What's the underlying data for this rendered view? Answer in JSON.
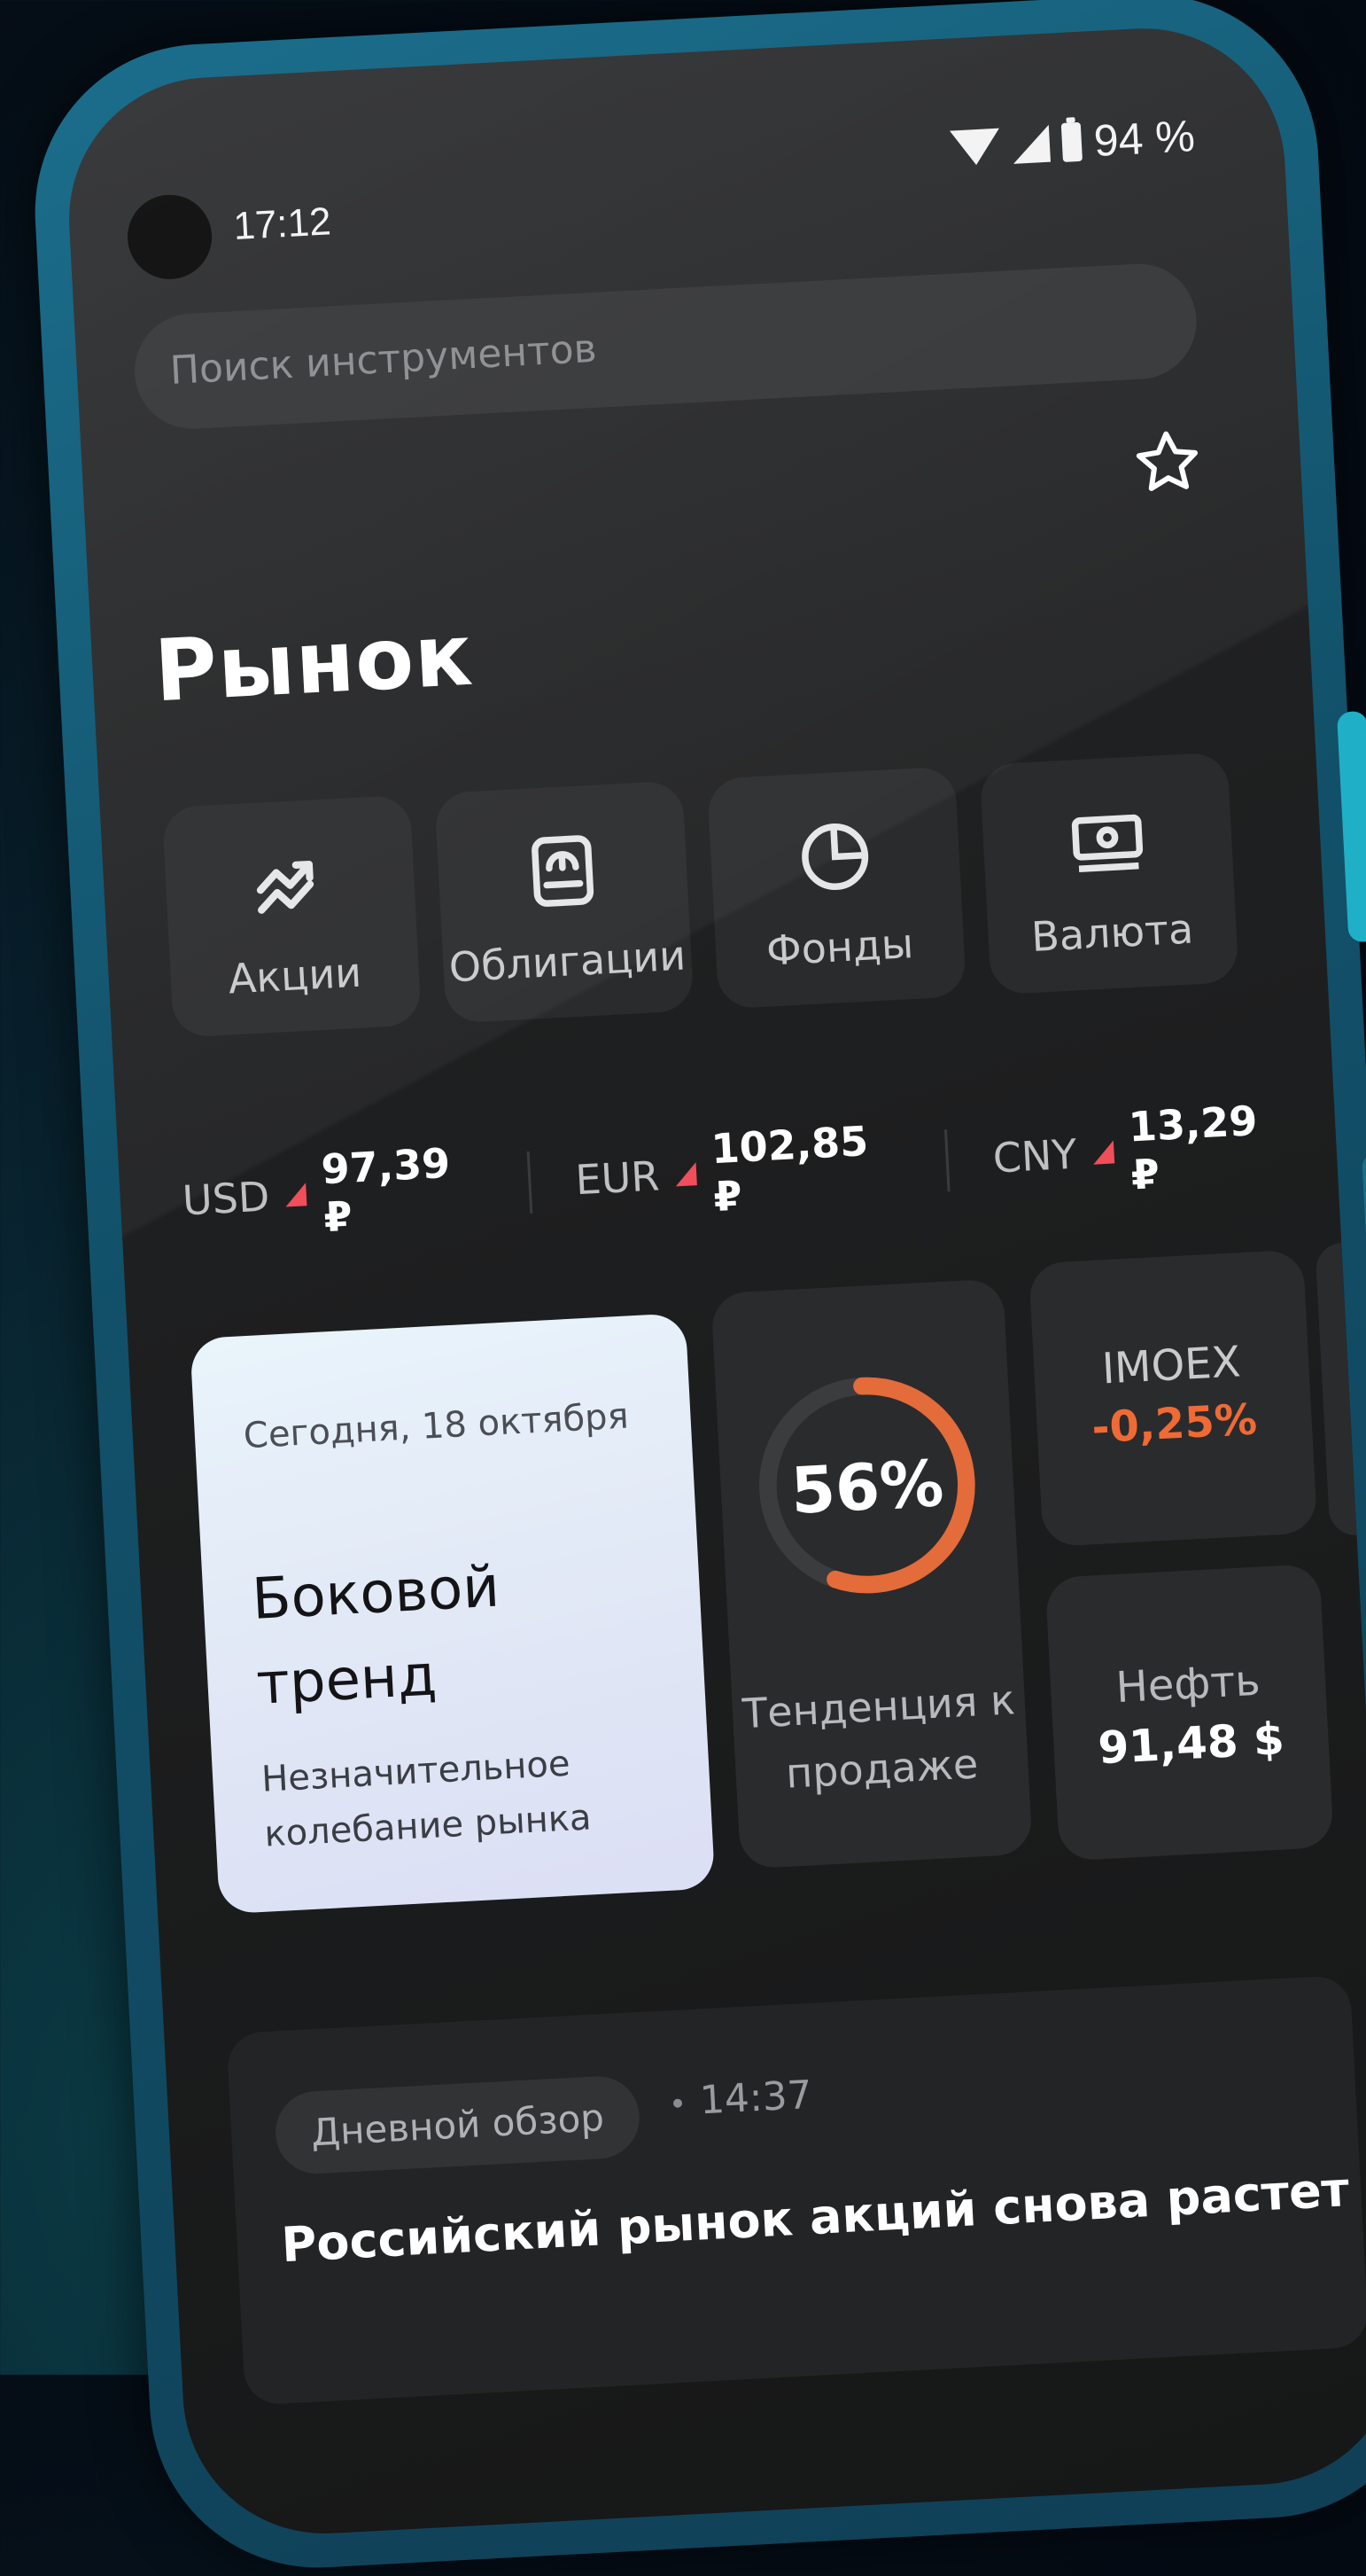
{
  "status_bar": {
    "time": "17:12",
    "battery": "94 %"
  },
  "search": {
    "placeholder": "Поиск инструментов"
  },
  "page": {
    "title": "Рынок"
  },
  "categories": [
    {
      "label": "Акции",
      "icon": "trend-chart-icon"
    },
    {
      "label": "Облигации",
      "icon": "bond-document-icon"
    },
    {
      "label": "Фонды",
      "icon": "pie-chart-icon"
    },
    {
      "label": "Валюта",
      "icon": "banknote-icon"
    }
  ],
  "rates": [
    {
      "code": "USD",
      "value": "97,39 ₽"
    },
    {
      "code": "EUR",
      "value": "102,85 ₽"
    },
    {
      "code": "CNY",
      "value": "13,29 ₽"
    }
  ],
  "day_card": {
    "date": "Сегодня, 18 октября",
    "headline": "Боковой тренд",
    "subtitle": "Незначительное колебание рынка"
  },
  "trend_card": {
    "percent": 56,
    "percent_label": "56%",
    "label": "Тенденция к продаже"
  },
  "imoex": {
    "name": "IMOEX",
    "change": "-0,25%"
  },
  "oil": {
    "name": "Нефть",
    "price": "91,48 $"
  },
  "news": {
    "tag": "Дневной обзор",
    "time": "14:37",
    "headline": "Российский рынок акций снова растет"
  },
  "colors": {
    "accent_orange": "#ef6a35",
    "down_red": "#f04e5a",
    "frame": "#12516a"
  }
}
